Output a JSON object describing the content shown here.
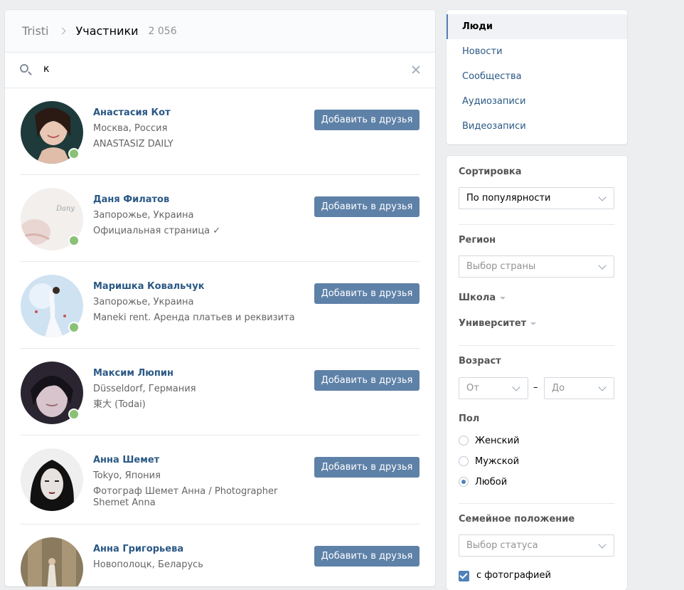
{
  "breadcrumb": {
    "group": "Tristi",
    "page": "Участники",
    "count": "2 056"
  },
  "search": {
    "value": "к"
  },
  "people": [
    {
      "name": "Анастасия Кот",
      "line1": "Москва, Россия",
      "line2": "ANASTASIZ DAILY",
      "online": true,
      "button": "Добавить в друзья"
    },
    {
      "name": "Даня Филатов",
      "line1": "Запорожье, Украина",
      "line2": "Официальная страница ✓",
      "online": true,
      "button": "Добавить в друзья"
    },
    {
      "name": "Маришка Ковальчук",
      "line1": "Запорожье, Украина",
      "line2": "Maneki rent. Аренда платьев и реквизита",
      "online": true,
      "button": "Добавить в друзья"
    },
    {
      "name": "Максим Люпин",
      "line1": "Düsseldorf, Германия",
      "line2": "東大 (Todai)",
      "online": true,
      "button": "Добавить в друзья"
    },
    {
      "name": "Анна Шемет",
      "line1": "Tokyo, Япония",
      "line2": "Фотограф Шемет Анна / Photographer",
      "line3": "Shemet Anna",
      "online": false,
      "button": "Добавить в друзья"
    },
    {
      "name": "Анна Григорьева",
      "line1": "Новополоцк, Беларусь",
      "line2": "",
      "online": false,
      "button": "Добавить в друзья"
    }
  ],
  "nav": {
    "items": [
      {
        "label": "Люди",
        "active": true
      },
      {
        "label": "Новости"
      },
      {
        "label": "Сообщества"
      },
      {
        "label": "Аудиозаписи"
      },
      {
        "label": "Видеозаписи"
      }
    ]
  },
  "filters": {
    "sort_label": "Сортировка",
    "sort_value": "По популярности",
    "region_label": "Регион",
    "region_placeholder": "Выбор страны",
    "school_label": "Школа",
    "university_label": "Университет",
    "age_label": "Возраст",
    "age_from": "От",
    "age_dash": "–",
    "age_to": "До",
    "sex_label": "Пол",
    "sex_options": [
      "Женский",
      "Мужской",
      "Любой"
    ],
    "sex_selected": "Любой",
    "family_label": "Семейное положение",
    "family_placeholder": "Выбор статуса",
    "photo_checkbox": "с фотографией"
  },
  "colors": {
    "link": "#2a5885",
    "button": "#5e81a8",
    "online": "#8ac176",
    "accent": "#5181b8"
  }
}
